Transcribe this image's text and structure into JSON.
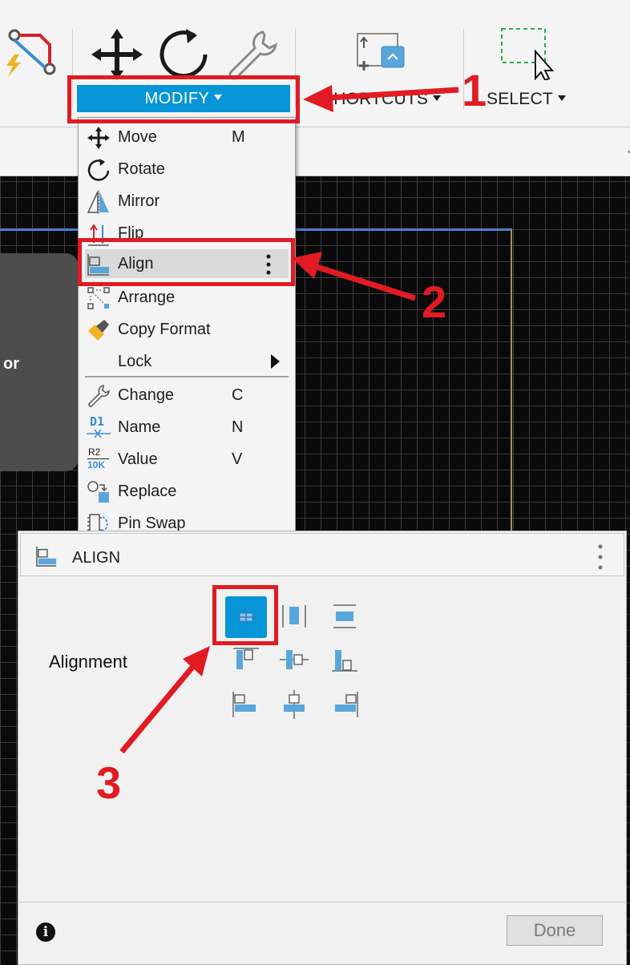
{
  "toolbar": {
    "modify_label": "MODIFY",
    "shortcuts_label": "SHORTCUTS",
    "select_label": "SELECT"
  },
  "side_text": "or",
  "menu": {
    "items": [
      {
        "label": "Move",
        "key": "M",
        "icon": "move-icon"
      },
      {
        "label": "Rotate",
        "key": "",
        "icon": "rotate-icon"
      },
      {
        "label": "Mirror",
        "key": "",
        "icon": "mirror-icon"
      },
      {
        "label": "Flip",
        "key": "",
        "icon": "flip-icon"
      },
      {
        "label": "Align",
        "key": "",
        "icon": "align-icon"
      },
      {
        "label": "Arrange",
        "key": "",
        "icon": "arrange-icon"
      },
      {
        "label": "Copy Format",
        "key": "",
        "icon": "copy-format-icon"
      },
      {
        "label": "Lock",
        "key": "",
        "icon": "lock-submenu"
      },
      {
        "label": "Change",
        "key": "C",
        "icon": "wrench-icon"
      },
      {
        "label": "Name",
        "key": "N",
        "icon": "name-icon",
        "icon_text": "D1"
      },
      {
        "label": "Value",
        "key": "V",
        "icon": "value-icon",
        "icon_text_top": "R2",
        "icon_text_bottom": "10K"
      },
      {
        "label": "Replace",
        "key": "",
        "icon": "replace-icon"
      },
      {
        "label": "Pin Swap",
        "key": "",
        "icon": "pin-swap-icon"
      }
    ]
  },
  "panel": {
    "title": "ALIGN",
    "alignment_label": "Alignment",
    "done_label": "Done",
    "info_glyph": "i"
  },
  "annotations": {
    "step1": "1",
    "step2": "2",
    "step3": "3",
    "color": "#e21b23"
  },
  "colors": {
    "accent": "#0696d7",
    "icon_blue": "#5aa6dc"
  }
}
